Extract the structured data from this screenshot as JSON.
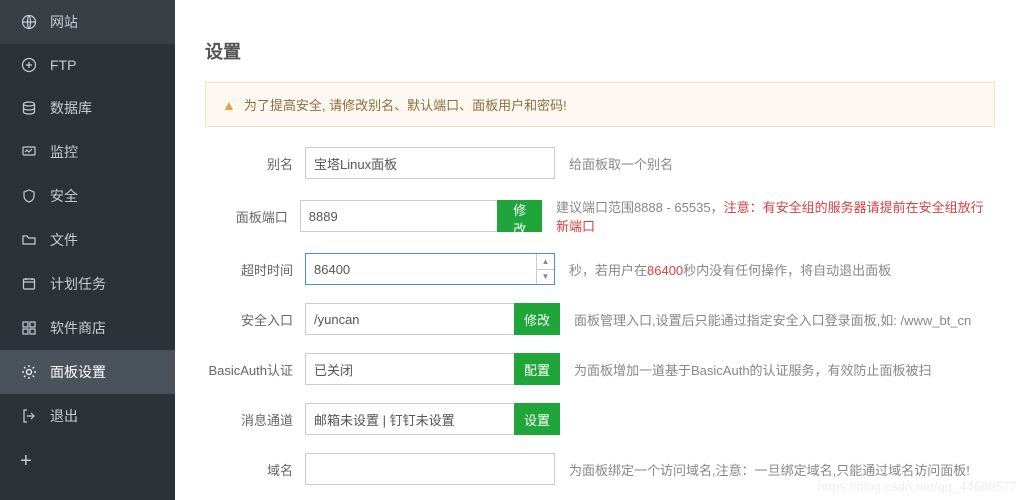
{
  "sidebar": {
    "items": [
      {
        "label": "网站"
      },
      {
        "label": "FTP"
      },
      {
        "label": "数据库"
      },
      {
        "label": "监控"
      },
      {
        "label": "安全"
      },
      {
        "label": "文件"
      },
      {
        "label": "计划任务"
      },
      {
        "label": "软件商店"
      },
      {
        "label": "面板设置"
      },
      {
        "label": "退出"
      }
    ],
    "add": "+"
  },
  "section_title": "设置",
  "alert": "为了提高安全, 请修改别名、默认端口、面板用户和密码!",
  "form": {
    "alias": {
      "label": "别名",
      "value": "宝塔Linux面板",
      "help": "给面板取一个别名"
    },
    "port": {
      "label": "面板端口",
      "value": "8889",
      "btn": "修改",
      "help_1": "建议端口范围8888 - 65535，",
      "help_red": "注意：有安全组的服务器请提前在安全组放行新端口"
    },
    "timeout": {
      "label": "超时时间",
      "value": "86400",
      "help_1": "秒，若用户在",
      "help_red": "86400",
      "help_2": "秒内没有任何操作，将自动退出面板"
    },
    "entry": {
      "label": "安全入口",
      "value": "/yuncan",
      "btn": "修改",
      "help": "面板管理入口,设置后只能通过指定安全入口登录面板,如: /www_bt_cn"
    },
    "basicauth": {
      "label": "BasicAuth认证",
      "value": "已关闭",
      "btn": "配置",
      "help": "为面板增加一道基于BasicAuth的认证服务，有效防止面板被扫"
    },
    "msg": {
      "label": "消息通道",
      "value": "邮箱未设置 | 钉钉未设置",
      "btn": "设置"
    },
    "domain": {
      "label": "域名",
      "value": "",
      "help": "为面板绑定一个访问域名,注意：一旦绑定域名,只能通过域名访问面板!"
    }
  },
  "watermark": "https://blog.csdn.net/qq_44680577"
}
